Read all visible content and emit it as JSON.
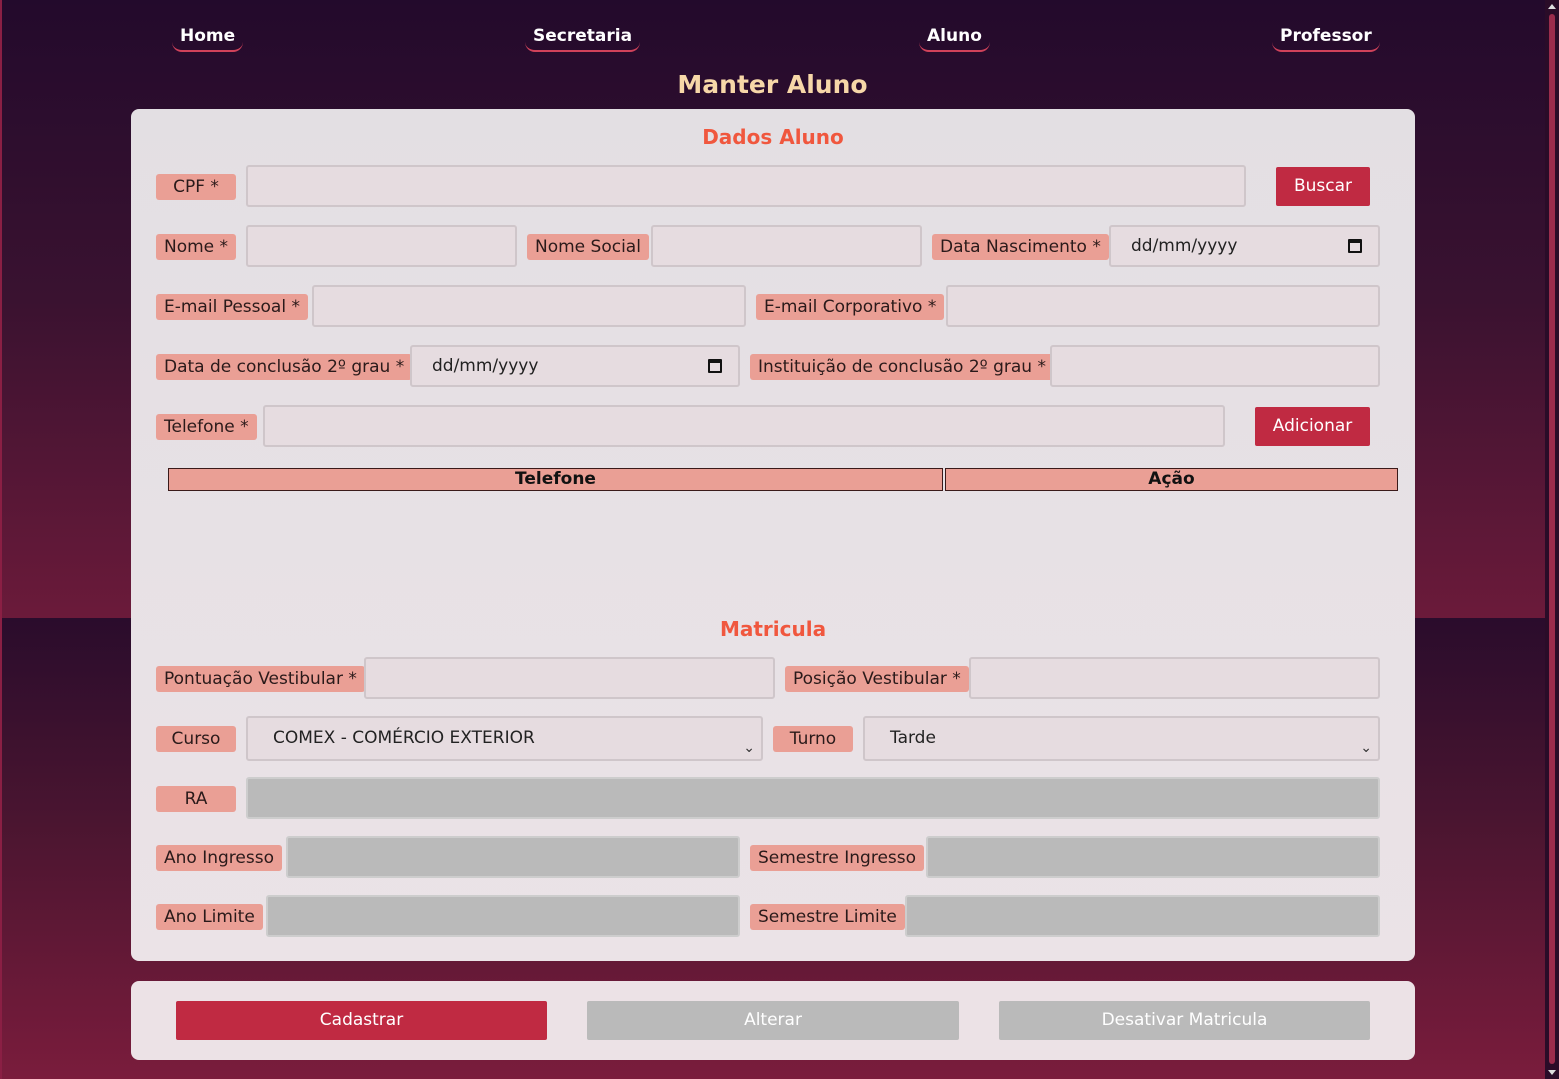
{
  "nav": {
    "home": "Home",
    "secretaria": "Secretaria",
    "aluno": "Aluno",
    "professor": "Professor"
  },
  "page_title": "Manter Aluno",
  "dados_aluno": {
    "section_title": "Dados Aluno",
    "cpf_label": "CPF *",
    "buscar_button": "Buscar",
    "nome_label": "Nome *",
    "nome_social_label": "Nome Social",
    "data_nascimento_label": "Data Nascimento *",
    "data_nascimento_value": "dd/mm/yyyy",
    "email_pessoal_label": "E-mail Pessoal *",
    "email_corporativo_label": "E-mail Corporativo *",
    "data_conclusao_label": "Data de conclusão 2º grau *",
    "data_conclusao_value": "dd/mm/yyyy",
    "instituicao_label": "Instituição de conclusão 2º grau *",
    "telefone_label": "Telefone *",
    "adicionar_button": "Adicionar",
    "table_headers": [
      "Telefone",
      "Ação"
    ]
  },
  "matricula": {
    "section_title": "Matricula",
    "pontuacao_label": "Pontuação Vestibular *",
    "posicao_label": "Posição Vestibular *",
    "curso_label": "Curso",
    "curso_value": "COMEX - COMÉRCIO EXTERIOR",
    "turno_label": "Turno",
    "turno_value": "Tarde",
    "ra_label": "RA",
    "ano_ingresso_label": "Ano Ingresso",
    "semestre_ingresso_label": "Semestre Ingresso",
    "ano_limite_label": "Ano Limite",
    "semestre_limite_label": "Semestre Limite"
  },
  "actions": {
    "cadastrar": "Cadastrar",
    "alterar": "Alterar",
    "desativar": "Desativar Matricula"
  },
  "colors": {
    "accent_red": "#c02a42",
    "label_bg": "#ea9f95",
    "section_title": "#f0573e",
    "page_title": "#f7d7a8"
  }
}
